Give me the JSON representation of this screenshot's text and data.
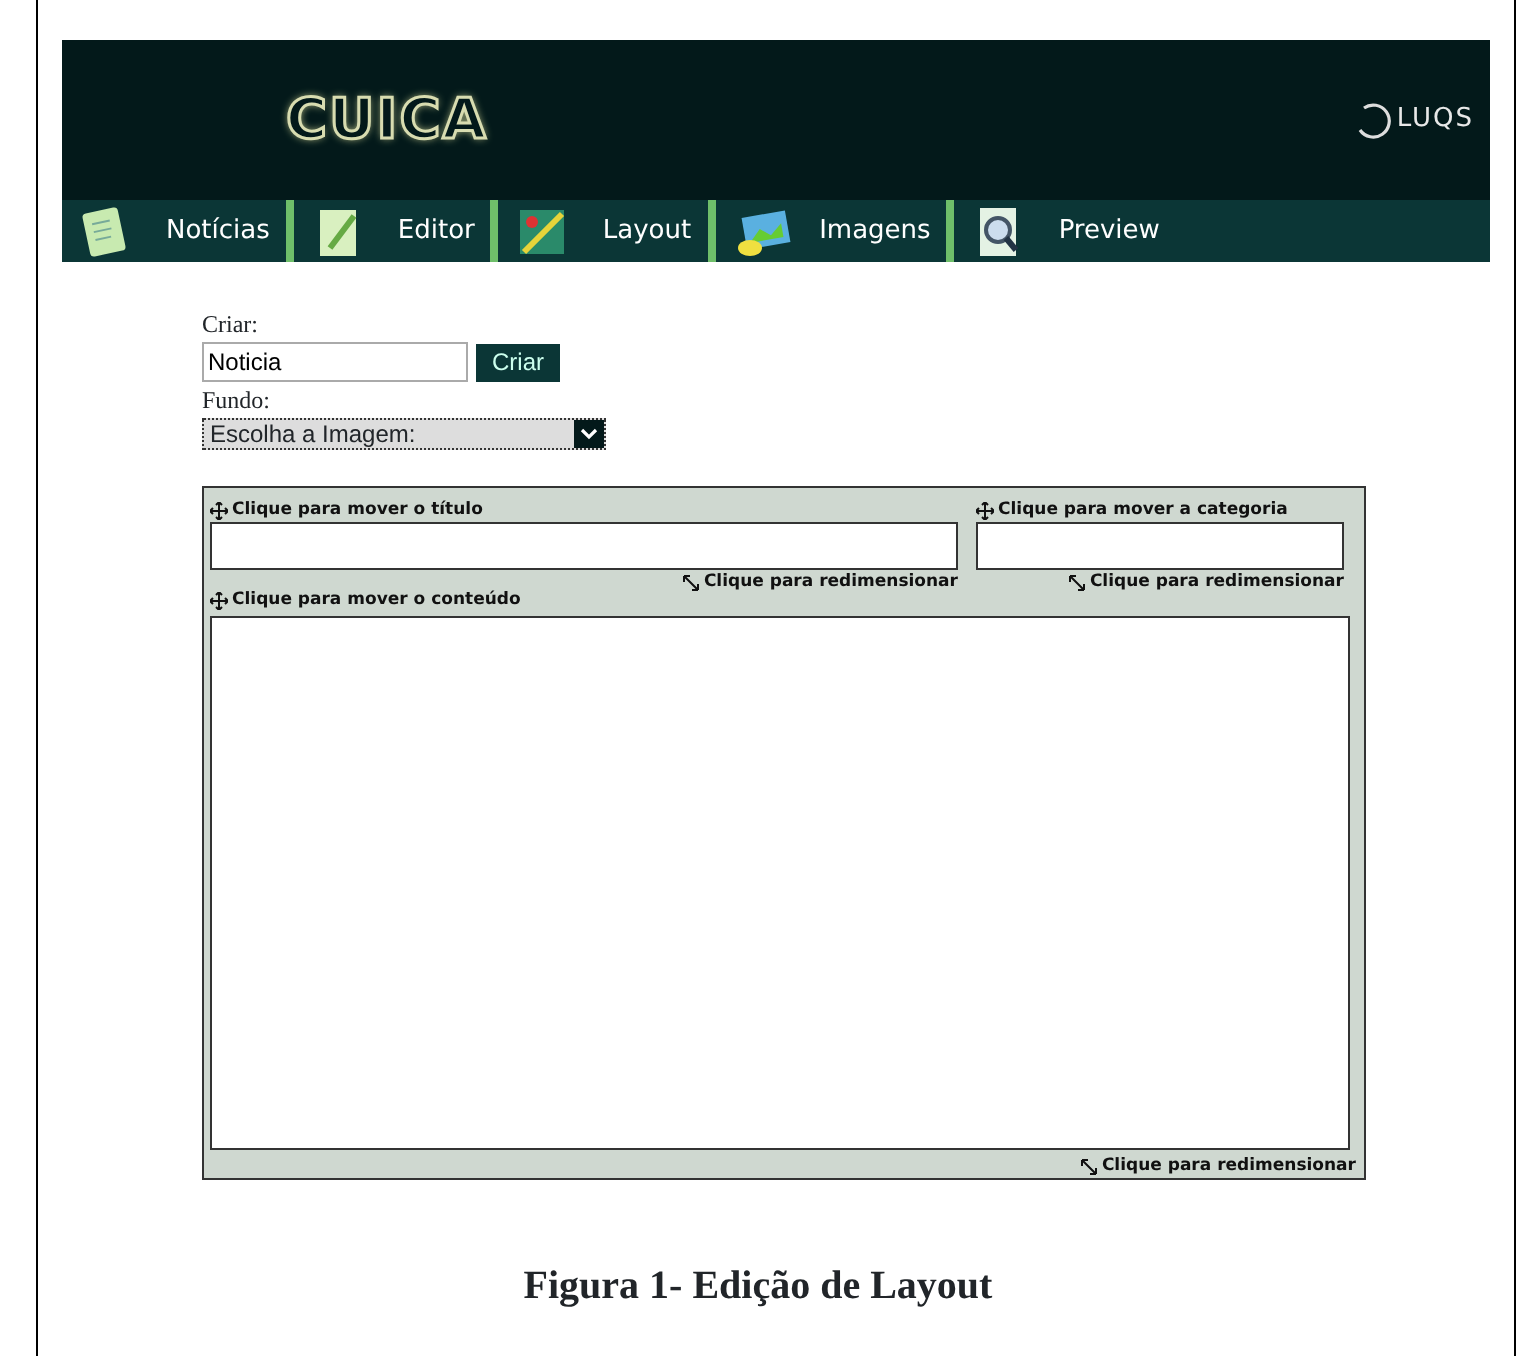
{
  "header": {
    "logo": "CUICA",
    "brand": "LUQS"
  },
  "tabs": [
    {
      "label": "Notícias",
      "kind": "news"
    },
    {
      "label": "Editor",
      "kind": "editor"
    },
    {
      "label": "Layout",
      "kind": "layout"
    },
    {
      "label": "Imagens",
      "kind": "images"
    },
    {
      "label": "Preview",
      "kind": "preview"
    }
  ],
  "form": {
    "create_label": "Criar:",
    "create_value": "Noticia",
    "create_button": "Criar",
    "background_label": "Fundo:",
    "background_select": "Escolha a Imagem:"
  },
  "layout_panel": {
    "title_move": "Clique para mover o título",
    "category_move": "Clique para mover a categoria",
    "title_resize": "Clique para redimensionar",
    "category_resize": "Clique para redimensionar",
    "content_move": "Clique para mover o conteúdo",
    "content_resize": "Clique para redimensionar"
  },
  "caption": "Figura 1- Edição de Layout"
}
